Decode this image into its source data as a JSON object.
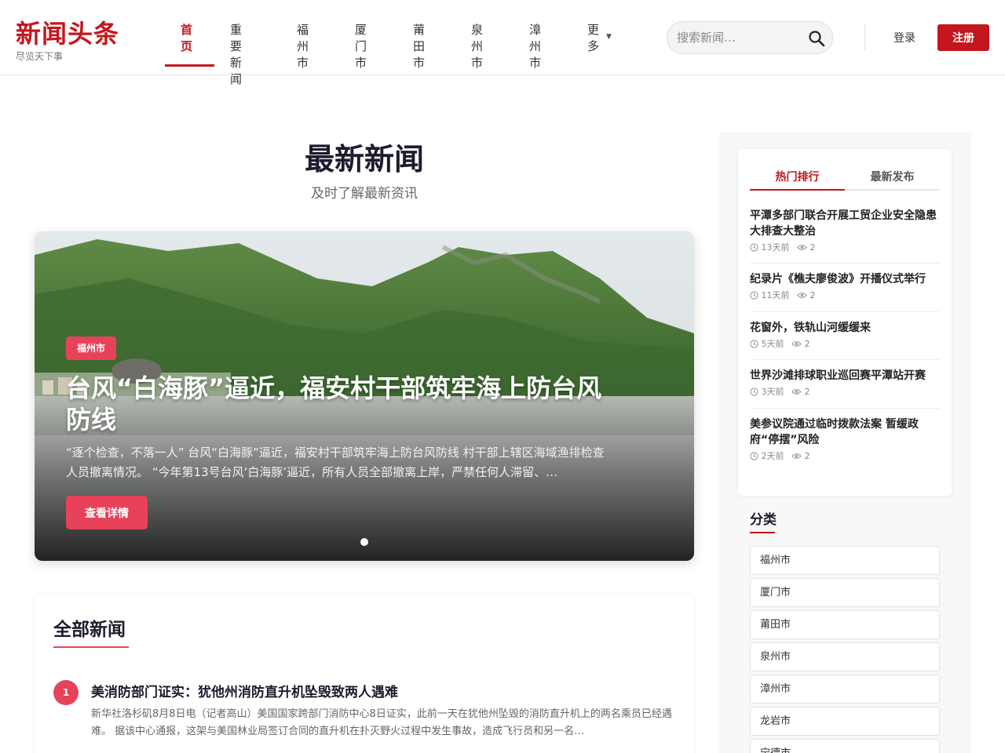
{
  "header": {
    "logo_title": "新闻头条",
    "logo_subtitle": "尽览天下事",
    "nav": [
      {
        "label": "首\n页"
      },
      {
        "label": "重要新\n闻"
      },
      {
        "label": "福州\n市"
      },
      {
        "label": "厦门\n市"
      },
      {
        "label": "莆田\n市"
      },
      {
        "label": "泉州\n市"
      },
      {
        "label": "漳州\n市"
      },
      {
        "label": "更\n多"
      }
    ],
    "search_placeholder": "搜索新闻…",
    "login_label": "登录",
    "register_label": "注册",
    "accent_color": "#c4161c"
  },
  "main": {
    "title": "最新新闻",
    "subtitle": "及时了解最新资讯"
  },
  "hero": {
    "badge": "福州市",
    "title": "台风“白海豚”逼近，福安村干部筑牢海上防台风防线",
    "desc": "“逐个检查，不落一人” 台风“白海豚”逼近，福安村干部筑牢海上防台风防线 村干部上辖区海域渔排检查人员撤离情况。 “今年第13号台风‘白海豚’逼近，所有人员全部撤离上岸，严禁任何人滞留、…",
    "button_label": "查看详情",
    "badge_color": "#e8425a"
  },
  "all_news": {
    "title": "全部新闻",
    "items": [
      {
        "rank": "1",
        "title": "美消防部门证实：犹他州消防直升机坠毁致两人遇难",
        "excerpt": "新华社洛杉矶8月8日电（记者高山）美国国家跨部门消防中心8日证实，此前一天在犹他州坠毁的消防直升机上的两名乘员已经遇难。 据该中心通报，这架与美国林业局签订合同的直升机在扑灭野火过程中发生事故，造成飞行员和另一名…"
      }
    ]
  },
  "sidebar": {
    "tabs": [
      {
        "label": "热门排行"
      },
      {
        "label": "最新发布"
      }
    ],
    "hot": [
      {
        "title": "平潭多部门联合开展工贸企业安全隐患大排查大整治",
        "time": "13天前",
        "views": "2"
      },
      {
        "title": "纪录片《樵夫廖俊波》开播仪式举行",
        "time": "11天前",
        "views": "2"
      },
      {
        "title": "花窗外，铁轨山河缓缓来",
        "time": "5天前",
        "views": "2"
      },
      {
        "title": "世界沙滩排球职业巡回赛平潭站开赛",
        "time": "3天前",
        "views": "2"
      },
      {
        "title": "美参议院通过临时拨款法案 暂缓政府“停摆”风险",
        "time": "2天前",
        "views": "2"
      }
    ],
    "categories_title": "分类",
    "categories": [
      "福州市",
      "厦门市",
      "莆田市",
      "泉州市",
      "漳州市",
      "龙岩市",
      "宁德市"
    ]
  }
}
